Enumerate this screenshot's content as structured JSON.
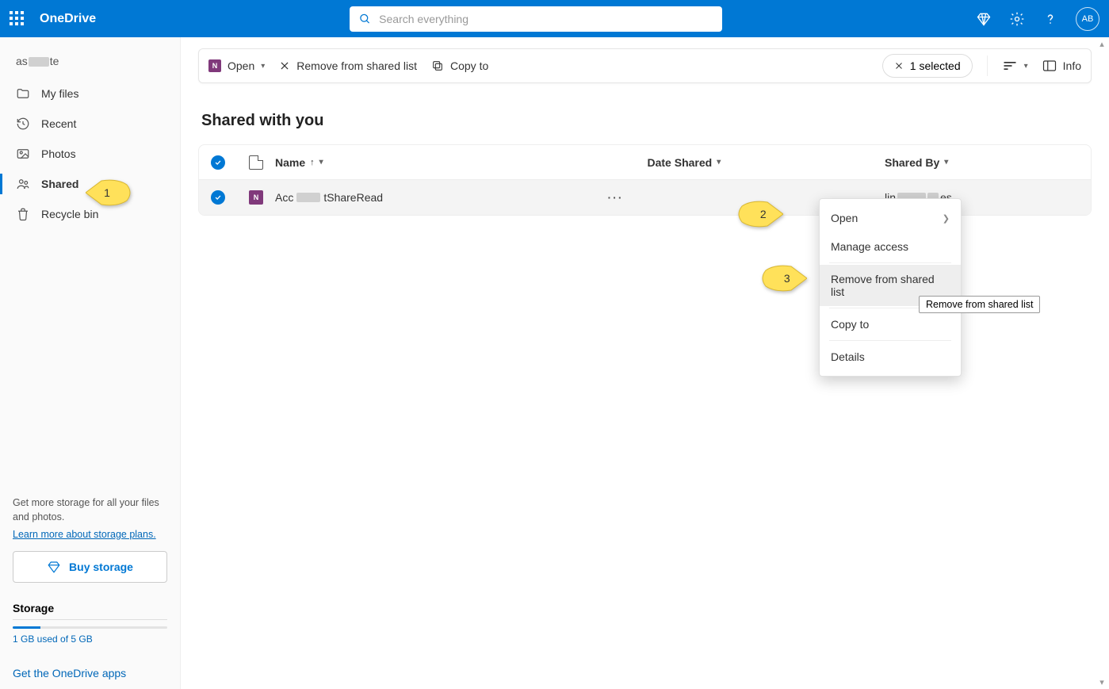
{
  "brand": "OneDrive",
  "search": {
    "placeholder": "Search everything"
  },
  "avatar_initials": "AB",
  "sidebar": {
    "user_prefix": "as",
    "user_suffix": "te",
    "items": [
      {
        "label": "My files"
      },
      {
        "label": "Recent"
      },
      {
        "label": "Photos"
      },
      {
        "label": "Shared"
      },
      {
        "label": "Recycle bin"
      }
    ],
    "storage_note": "Get more storage for all your files and photos.",
    "storage_link": "Learn more about storage plans.",
    "buy_label": "Buy storage",
    "storage_heading": "Storage",
    "storage_used": "1 GB used of 5 GB",
    "get_apps": "Get the OneDrive apps"
  },
  "cmdbar": {
    "open": "Open",
    "remove": "Remove from shared list",
    "copy": "Copy to",
    "selected": "1 selected",
    "info": "Info"
  },
  "page_title": "Shared with you",
  "table": {
    "headers": {
      "name": "Name",
      "date": "Date Shared",
      "by": "Shared By"
    },
    "row": {
      "name_prefix": "Acc",
      "name_suffix": "tShareRead",
      "by_prefix": "lin",
      "by_suffix": "es"
    }
  },
  "ctx": {
    "open": "Open",
    "manage": "Manage access",
    "remove": "Remove from shared list",
    "copy": "Copy to",
    "details": "Details"
  },
  "tooltip": "Remove from shared list",
  "callouts": {
    "one": "1",
    "two": "2",
    "three": "3"
  }
}
